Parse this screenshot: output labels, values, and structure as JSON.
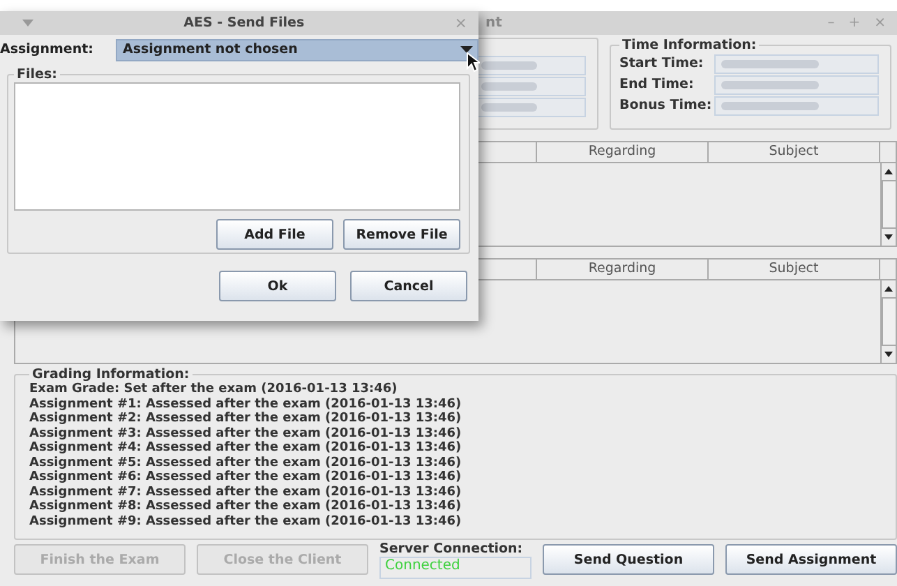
{
  "window": {
    "title": "nt",
    "controls": [
      "–",
      "+",
      "×"
    ]
  },
  "time_information": {
    "title": "Time Information:",
    "rows": [
      {
        "label": "Start Time:"
      },
      {
        "label": "End Time:"
      },
      {
        "label": "Bonus Time:"
      }
    ]
  },
  "tables": [
    {
      "columns": [
        "Regarding",
        "Subject"
      ]
    },
    {
      "columns": [
        "Regarding",
        "Subject"
      ]
    }
  ],
  "grading": {
    "title": "Grading Information:",
    "lines": [
      "Exam Grade: Set after the exam (2016-01-13 13:46)",
      "Assignment #1: Assessed after the exam (2016-01-13 13:46)",
      "Assignment #2: Assessed after the exam (2016-01-13 13:46)",
      "Assignment #3: Assessed after the exam (2016-01-13 13:46)",
      "Assignment #4: Assessed after the exam (2016-01-13 13:46)",
      "Assignment #5: Assessed after the exam (2016-01-13 13:46)",
      "Assignment #6: Assessed after the exam (2016-01-13 13:46)",
      "Assignment #7: Assessed after the exam (2016-01-13 13:46)",
      "Assignment #8: Assessed after the exam (2016-01-13 13:46)",
      "Assignment #9: Assessed after the exam (2016-01-13 13:46)"
    ]
  },
  "bottom_buttons": [
    {
      "label": "Finish the Exam",
      "disabled": true
    },
    {
      "label": "Close the Client",
      "disabled": true
    }
  ],
  "server_connection": {
    "label": "Server Connection:",
    "value": "Connected"
  },
  "action_buttons": [
    {
      "label": "Send Question",
      "disabled": false
    },
    {
      "label": "Send Assignment",
      "disabled": false
    }
  ],
  "dialog": {
    "title": "AES - Send Files",
    "close": "×",
    "assignment_label": "Assignment:",
    "assignment_value": "Assignment not chosen",
    "files_title": "Files:",
    "file_buttons": [
      "Add File",
      "Remove File"
    ],
    "buttons": [
      "Ok",
      "Cancel"
    ]
  }
}
